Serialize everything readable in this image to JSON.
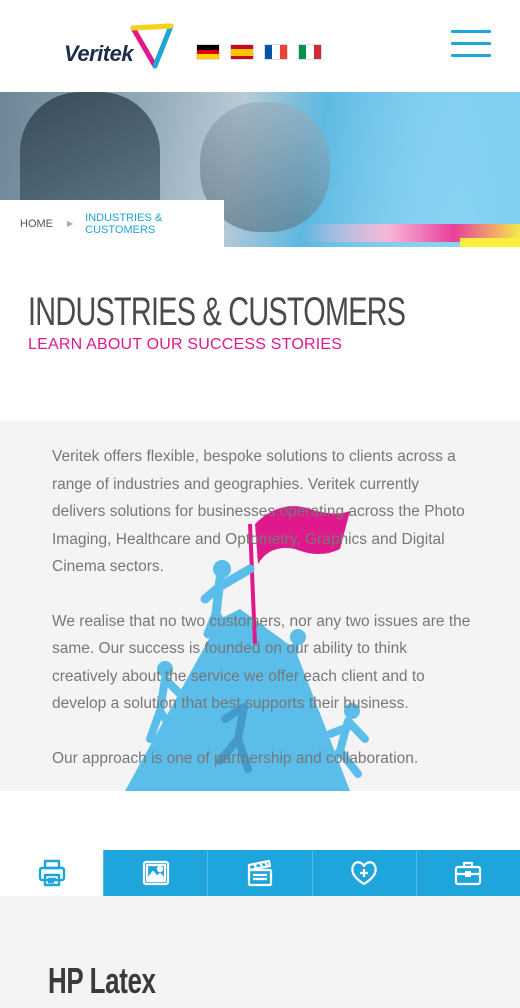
{
  "brand": {
    "name": "Veritek"
  },
  "languages": [
    {
      "name": "Deutsch",
      "colors": [
        "#000000",
        "#dd0000",
        "#ffce00"
      ],
      "orientation": "horizontal"
    },
    {
      "name": "Español",
      "colors": [
        "#c60b1e",
        "#ffc400",
        "#c60b1e"
      ],
      "orientation": "horizontal"
    },
    {
      "name": "Français",
      "colors": [
        "#0055a4",
        "#ffffff",
        "#ef4135"
      ],
      "orientation": "vertical"
    },
    {
      "name": "Italiano",
      "colors": [
        "#009246",
        "#ffffff",
        "#ce2b37"
      ],
      "orientation": "vertical"
    }
  ],
  "breadcrumb": {
    "home": "HOME",
    "current": "INDUSTRIES & CUSTOMERS"
  },
  "page": {
    "title": "INDUSTRIES & CUSTOMERS",
    "subtitle": "LEARN ABOUT OUR SUCCESS STORIES"
  },
  "body": {
    "paragraphs": [
      "Veritek offers flexible, bespoke solutions to clients across a range of industries and geographies. Veritek currently delivers solutions for businesses operating across the Photo Imaging, Healthcare and Optometry, Graphics and Digital Cinema sectors.",
      "We realise that no two customers, nor any two issues are the same. Our success is founded on our ability to think creatively about the service we offer each client and to develop a solution that best supports their business.",
      "Our approach is one of partnership and collaboration."
    ]
  },
  "tabs": [
    {
      "icon": "printer-icon",
      "active": true
    },
    {
      "icon": "image-icon",
      "active": false
    },
    {
      "icon": "clapperboard-icon",
      "active": false
    },
    {
      "icon": "heart-care-icon",
      "active": false
    },
    {
      "icon": "briefcase-icon",
      "active": false
    }
  ],
  "section": {
    "title": "HP Latex"
  },
  "colors": {
    "accent": "#1ea5dc",
    "magenta": "#e0188d",
    "illustration": "#5bbde9"
  }
}
